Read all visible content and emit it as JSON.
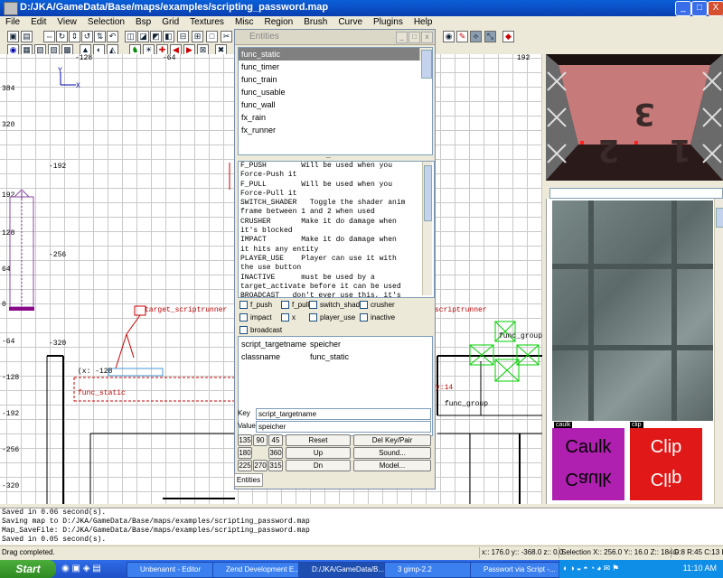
{
  "window": {
    "title": "D:/JKA/GameData/Base/maps/examples/scripting_password.map",
    "btn_min": "_",
    "btn_max": "□",
    "btn_close": "X"
  },
  "menu": [
    "File",
    "Edit",
    "View",
    "Selection",
    "Bsp",
    "Grid",
    "Textures",
    "Misc",
    "Region",
    "Brush",
    "Curve",
    "Plugins",
    "Help"
  ],
  "gridview": {
    "x_ticks": [
      "-128",
      "-64",
      "192"
    ],
    "y_ticks": [
      "384",
      "320",
      "-192",
      "192",
      "128",
      "-256",
      "64",
      "0",
      "-64",
      "-320",
      "-128",
      "-192",
      "-256",
      "-320"
    ],
    "axis_y": "Y",
    "axis_x": "X",
    "ent_labels": {
      "scriptrunner_left": "target_scriptrunner",
      "scriptrunner_right": "scriptrunner",
      "func_group1": "func_group",
      "func_group2": "func_group",
      "func_static": "func_static",
      "coord": "(x: -128",
      "small_red": "y:14"
    }
  },
  "entities": {
    "title": "Entities",
    "list": [
      "func_static",
      "func_timer",
      "func_train",
      "func_usable",
      "func_wall",
      "fx_rain",
      "fx_runner"
    ],
    "selected": 0,
    "description": "F_PUSH        Will be used when you\nForce-Push it\nF_PULL        Will be used when you\nForce-Pull it\nSWITCH_SHADER   Toggle the shader anim\nframe between 1 and 2 when used\nCRUSHER       Make it do damage when\nit's blocked\nIMPACT        Make it do damage when\nit hits any entity\nPLAYER_USE    Player can use it with\nthe use button\nINACTIVE      must be used by a\ntarget_activate before it can be used\nBROADCAST   don't ever use this, it's",
    "flags": [
      "f_push",
      "f_pull",
      "switch_shader",
      "crusher",
      "impact",
      "x",
      "player_use",
      "inactive",
      "broadcast"
    ],
    "kv": [
      {
        "key": "script_targetname",
        "value": "speicher"
      },
      {
        "key": "classname",
        "value": "func_static"
      }
    ],
    "key_label": "Key",
    "key_value": "script_targetname",
    "value_label": "Value",
    "value_value": "speicher",
    "angles": [
      "135",
      "90",
      "45",
      "180",
      "360",
      "225",
      "270",
      "315"
    ],
    "buttons": {
      "reset": "Reset",
      "up": "Up",
      "dn": "Dn",
      "delkey": "Del Key/Pair",
      "sound": "Sound...",
      "model": "Model..."
    },
    "tab": "Entities"
  },
  "camera": {
    "digits": "1 2 3"
  },
  "textures": {
    "tex1": "caulk",
    "tex2": "clip",
    "caulk_big": "Caulk",
    "clip_big": "Clip"
  },
  "console": "Saved in 0.06 second(s).\nSaving map to D:/JKA/GameData/Base/maps/examples/scripting_password.map\nMap_SaveFile: D:/JKA/GameData/Base/maps/examples/scripting_password.map\nSaved in 0.05 second(s).",
  "status": {
    "msg": "Drag completed.",
    "coords": "x:: 176.0  y:: -368.0  z:: 0.0",
    "selection": "Selection X:: 256.0  Y:: 16.0  Z:: 184.0",
    "grid": "G:8 R:45 C:13 L:"
  },
  "taskbar": {
    "start": "Start",
    "tasks": [
      "Unbenannt - Editor",
      "Zend Development E...",
      "D:/JKA/GameData/B...",
      "3 gimp-2.2",
      "Passwort via Script -...",
      "Passwort via Script -..."
    ],
    "clock": "11:10 AM"
  }
}
